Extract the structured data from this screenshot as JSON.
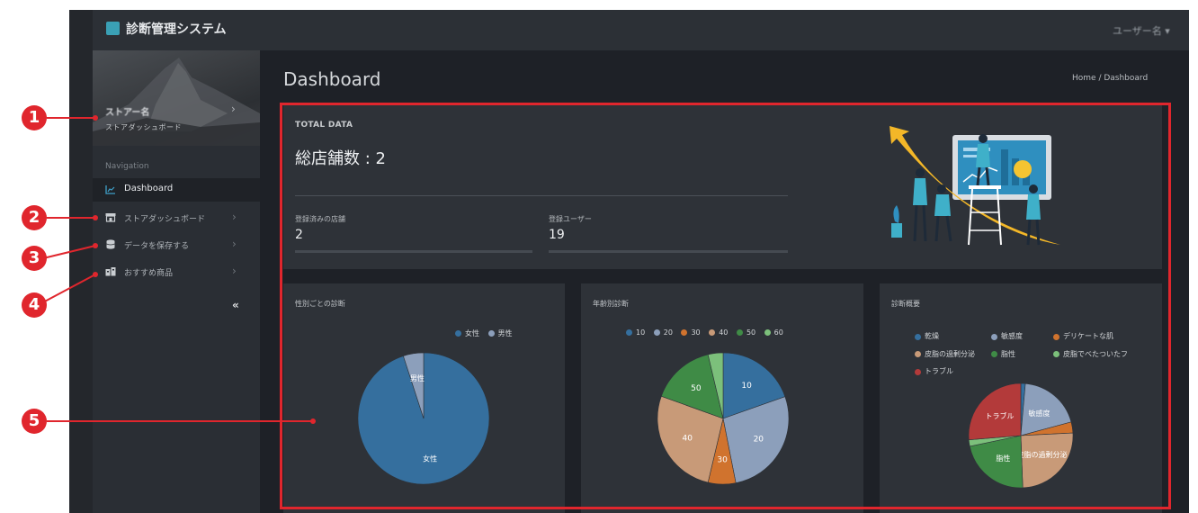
{
  "app": {
    "title": "診断管理システム",
    "user_menu": "ユーザー名"
  },
  "colors": {
    "accent_red": "#e0262d",
    "topbar": "#2c3036",
    "sidebar": "#2a2e34",
    "panel": "#2e3238"
  },
  "sidebar": {
    "profile": {
      "name": "ストアー名",
      "subtitle": "ストアダッシュボード"
    },
    "nav_header": "Navigation",
    "items": [
      {
        "label": "Dashboard",
        "icon": "chart-icon",
        "active": true
      },
      {
        "label": "ストアダッシュボード",
        "icon": "store-icon",
        "active": false
      },
      {
        "label": "データを保存する",
        "icon": "database-icon",
        "active": false
      },
      {
        "label": "おすすめ商品",
        "icon": "products-icon",
        "active": false
      }
    ],
    "collapse": "«"
  },
  "page": {
    "title": "Dashboard",
    "breadcrumb": "Home  /  Dashboard"
  },
  "total": {
    "heading": "TOTAL DATA",
    "main": "総店舗数 : 2",
    "stats": [
      {
        "label": "登録済みの店舗",
        "value": "2"
      },
      {
        "label": "登録ユーザー",
        "value": "19"
      }
    ]
  },
  "charts": {
    "gender": {
      "title": "性別ごとの診断",
      "legend": [
        {
          "name": "女性",
          "color": "#356f9e"
        },
        {
          "name": "男性",
          "color": "#8c9fbb"
        }
      ]
    },
    "age": {
      "title": "年齢別診断",
      "legend": [
        {
          "name": "10",
          "color": "#356f9e"
        },
        {
          "name": "20",
          "color": "#8c9fbb"
        },
        {
          "name": "30",
          "color": "#d0732e"
        },
        {
          "name": "40",
          "color": "#c89a78"
        },
        {
          "name": "50",
          "color": "#3f8b46"
        },
        {
          "name": "60",
          "color": "#7cc07b"
        }
      ]
    },
    "summary": {
      "title": "診断概要",
      "legend": [
        {
          "name": "乾燥",
          "color": "#356f9e"
        },
        {
          "name": "敏感度",
          "color": "#8c9fbb"
        },
        {
          "name": "デリケートな肌",
          "color": "#d0732e"
        },
        {
          "name": "皮脂の過剰分泌",
          "color": "#c89a78"
        },
        {
          "name": "脂性",
          "color": "#3f8b46"
        },
        {
          "name": "皮脂でべたついたフ",
          "color": "#7cc07b"
        },
        {
          "name": "トラブル",
          "color": "#b33a3a"
        }
      ]
    }
  },
  "chart_data": [
    {
      "type": "pie",
      "title": "性別ごとの診断",
      "categories": [
        "女性",
        "男性"
      ],
      "values": [
        95,
        5
      ],
      "colors": [
        "#356f9e",
        "#8c9fbb"
      ],
      "slice_labels": [
        "女性",
        "男性"
      ],
      "legend": "top-right"
    },
    {
      "type": "pie",
      "title": "年齢別診断",
      "categories": [
        "10",
        "20",
        "30",
        "40",
        "50",
        "60"
      ],
      "values": [
        19.6,
        27.3,
        6.8,
        26.8,
        15.8,
        3.7
      ],
      "colors": [
        "#356f9e",
        "#8c9fbb",
        "#d0732e",
        "#c89a78",
        "#3f8b46",
        "#7cc07b"
      ],
      "slice_labels": [
        "10",
        "20",
        "30",
        "40",
        "50",
        ""
      ],
      "legend": "top"
    },
    {
      "type": "pie",
      "title": "診断概要",
      "categories": [
        "乾燥",
        "敏感度",
        "デリケートな肌",
        "皮脂の過剰分泌",
        "脂性",
        "皮脂でべたついたフ",
        "トラブル"
      ],
      "values": [
        1.4,
        19.4,
        3.4,
        25.2,
        22.3,
        2.0,
        26.3
      ],
      "colors": [
        "#356f9e",
        "#8c9fbb",
        "#d0732e",
        "#c89a78",
        "#3f8b46",
        "#7cc07b",
        "#b33a3a"
      ],
      "slice_labels": [
        "",
        "敏感度",
        "",
        "皮脂の過剰分泌",
        "脂性",
        "",
        "トラブル"
      ],
      "legend": "top"
    }
  ],
  "callouts": [
    "1",
    "2",
    "3",
    "4",
    "5"
  ]
}
